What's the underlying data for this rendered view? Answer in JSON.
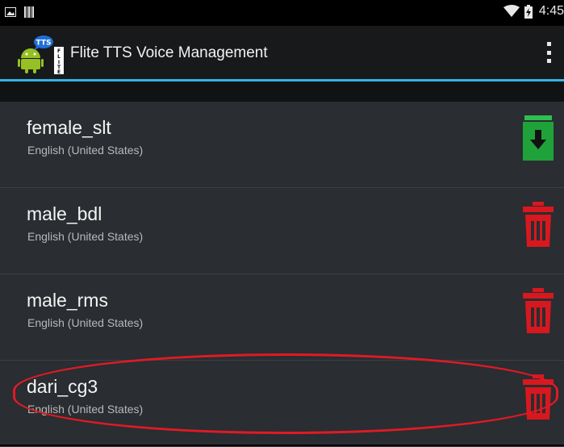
{
  "status_bar": {
    "time": "4:45",
    "icons": [
      "image-notification-icon",
      "barcode-notification-icon",
      "wifi-icon",
      "battery-icon"
    ]
  },
  "action_bar": {
    "title": "Flite TTS Voice Management",
    "app_icon": "flite-tts-android-icon",
    "overflow_icon": "overflow-menu-icon"
  },
  "voices": [
    {
      "name": "female_slt",
      "language": "English (United States)",
      "action": "download",
      "action_icon": "download-icon",
      "action_color": "#1fa23a"
    },
    {
      "name": "male_bdl",
      "language": "English (United States)",
      "action": "delete",
      "action_icon": "trash-icon",
      "action_color": "#d7181f"
    },
    {
      "name": "male_rms",
      "language": "English (United States)",
      "action": "delete",
      "action_icon": "trash-icon",
      "action_color": "#d7181f"
    },
    {
      "name": "dari_cg3",
      "language": "English (United States)",
      "action": "delete",
      "action_icon": "trash-icon",
      "action_color": "#d7181f",
      "highlighted": true
    }
  ],
  "colors": {
    "accent": "#33b5e5",
    "highlight": "#e01a25",
    "background": "#101214",
    "list_item": "#2a2d31"
  }
}
